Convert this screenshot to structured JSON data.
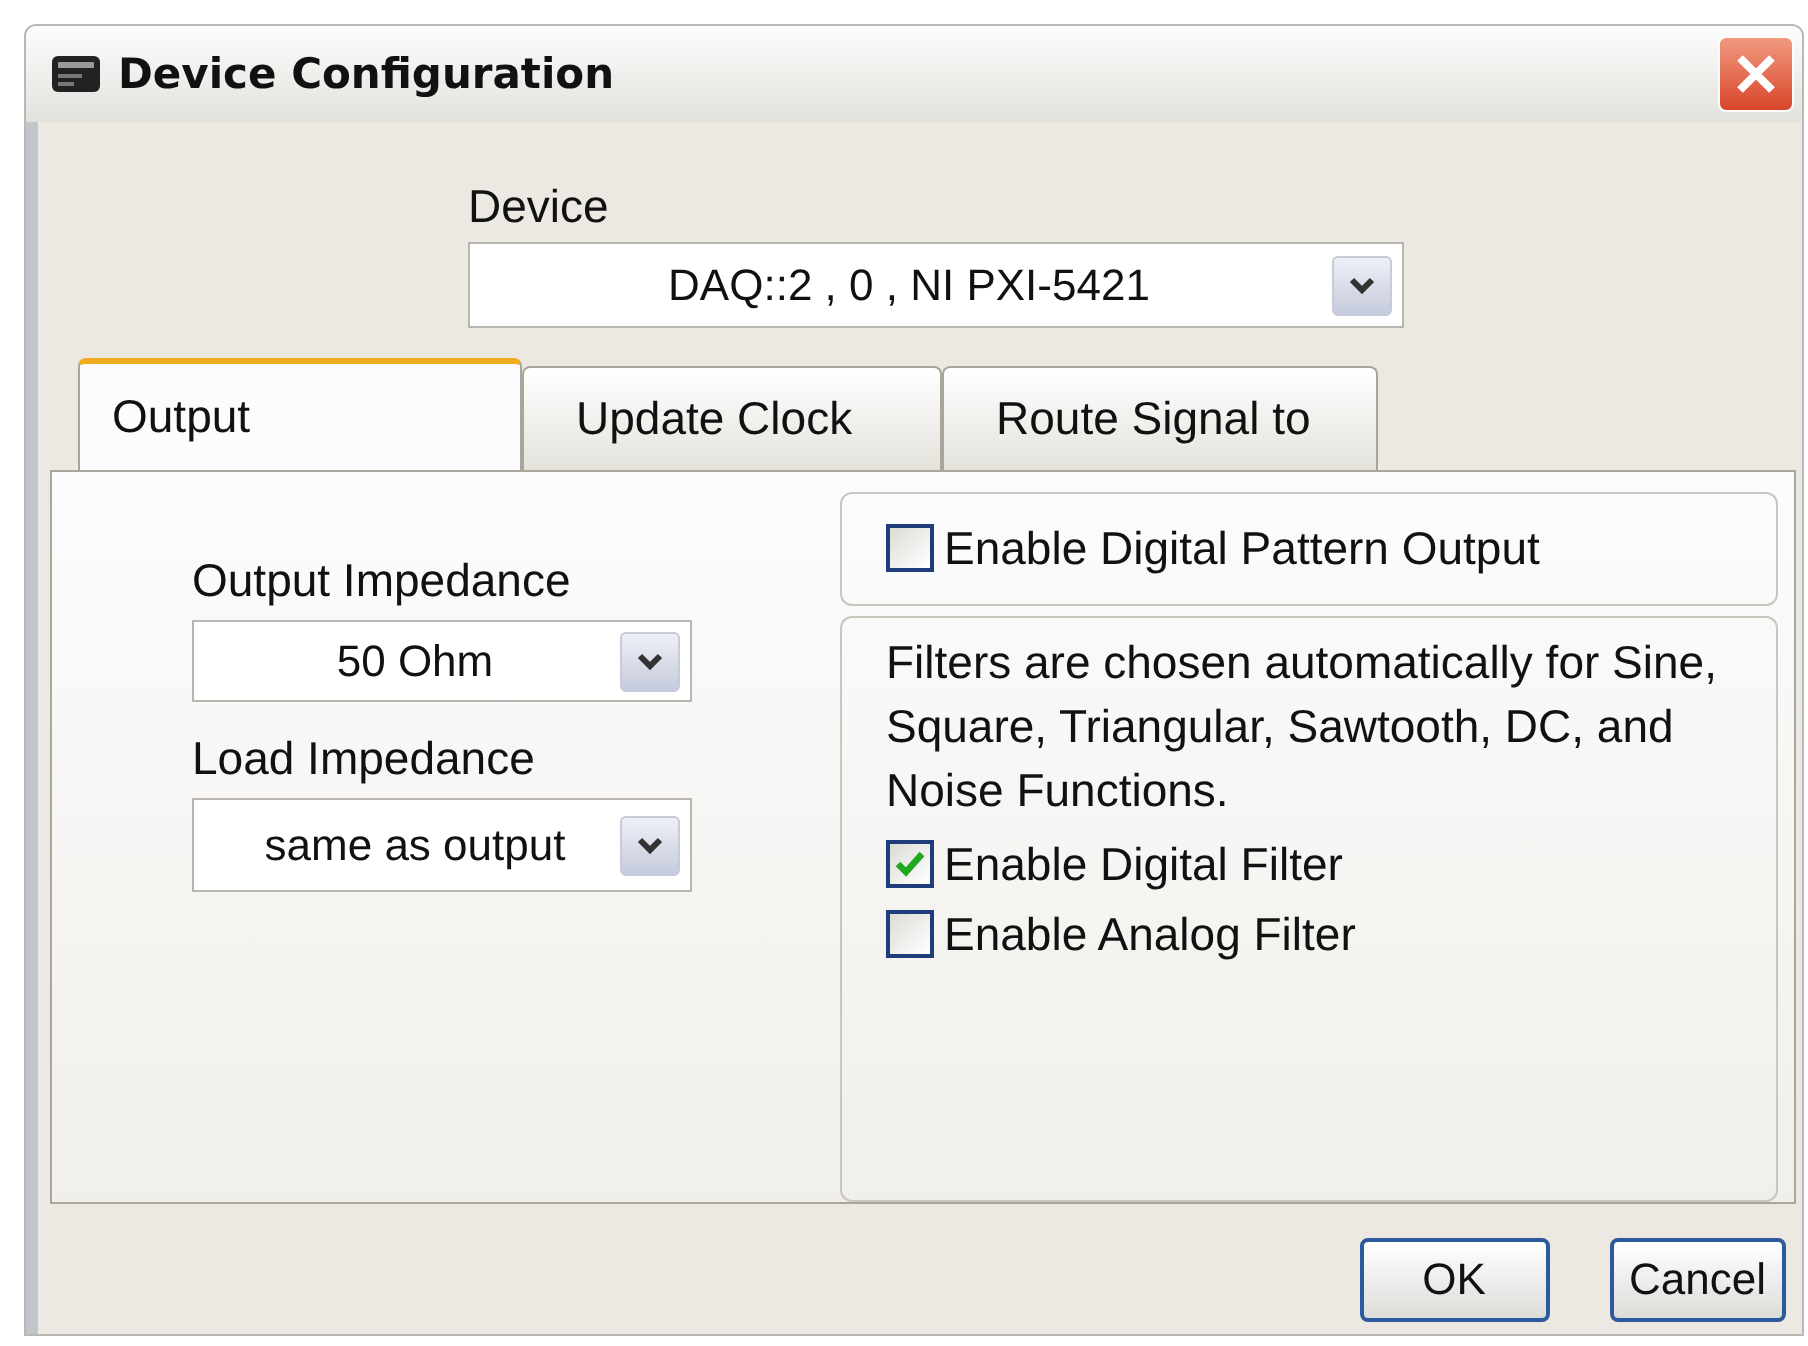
{
  "window": {
    "title": "Device Configuration"
  },
  "device": {
    "label": "Device",
    "value": "DAQ::2 , 0 , NI PXI-5421"
  },
  "tabs": [
    {
      "label": "Output",
      "selected": true
    },
    {
      "label": "Update Clock",
      "selected": false
    },
    {
      "label": "Route Signal to",
      "selected": false
    }
  ],
  "output_impedance": {
    "label": "Output Impedance",
    "value": "50 Ohm"
  },
  "load_impedance": {
    "label": "Load Impedance",
    "value": "same as output"
  },
  "pattern_output": {
    "label": "Enable Digital Pattern Output",
    "checked": false
  },
  "filters": {
    "note": "Filters are chosen automatically for Sine, Square, Triangular, Sawtooth, DC, and Noise Functions.",
    "options": [
      {
        "label": "Enable Digital Filter",
        "checked": true
      },
      {
        "label": "Enable Analog Filter",
        "checked": false
      }
    ]
  },
  "buttons": [
    "OK",
    "Cancel"
  ]
}
